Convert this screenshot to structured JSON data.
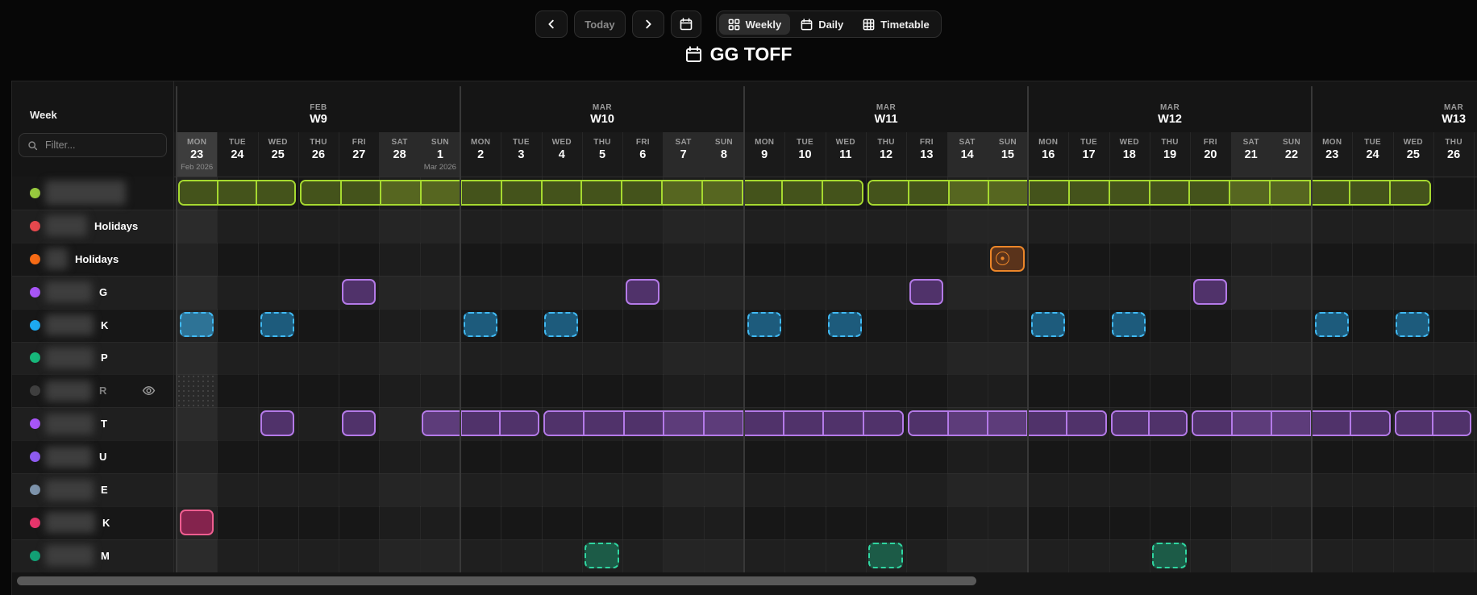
{
  "toolbar": {
    "prev_icon": "chevron-left-icon",
    "today_label": "Today",
    "next_icon": "chevron-right-icon",
    "date_picker_icon": "calendar-icon",
    "views": [
      {
        "label": "Weekly",
        "icon": "grid-icon",
        "active": true
      },
      {
        "label": "Daily",
        "icon": "calendar-icon",
        "active": false
      },
      {
        "label": "Timetable",
        "icon": "table-icon",
        "active": false
      }
    ]
  },
  "header": {
    "title": "GG TOFF",
    "title_icon": "calendar-icon"
  },
  "sidebar": {
    "heading": "Week",
    "filter_placeholder": "Filter...",
    "search_icon": "search-icon"
  },
  "calendar": {
    "weeks": [
      {
        "month": "FEB",
        "label": "W9",
        "days": [
          {
            "dow": "MON",
            "num": "23",
            "sub": "Feb 2026",
            "today": true
          },
          {
            "dow": "TUE",
            "num": "24"
          },
          {
            "dow": "WED",
            "num": "25"
          },
          {
            "dow": "THU",
            "num": "26"
          },
          {
            "dow": "FRI",
            "num": "27"
          },
          {
            "dow": "SAT",
            "num": "28",
            "weekend": true
          },
          {
            "dow": "SUN",
            "num": "1",
            "weekend": true,
            "sub": "Mar 2026"
          }
        ]
      },
      {
        "month": "MAR",
        "label": "W10",
        "days": [
          {
            "dow": "MON",
            "num": "2"
          },
          {
            "dow": "TUE",
            "num": "3"
          },
          {
            "dow": "WED",
            "num": "4"
          },
          {
            "dow": "THU",
            "num": "5"
          },
          {
            "dow": "FRI",
            "num": "6"
          },
          {
            "dow": "SAT",
            "num": "7",
            "weekend": true
          },
          {
            "dow": "SUN",
            "num": "8",
            "weekend": true
          }
        ]
      },
      {
        "month": "MAR",
        "label": "W11",
        "days": [
          {
            "dow": "MON",
            "num": "9"
          },
          {
            "dow": "TUE",
            "num": "10"
          },
          {
            "dow": "WED",
            "num": "11"
          },
          {
            "dow": "THU",
            "num": "12"
          },
          {
            "dow": "FRI",
            "num": "13"
          },
          {
            "dow": "SAT",
            "num": "14",
            "weekend": true
          },
          {
            "dow": "SUN",
            "num": "15",
            "weekend": true
          }
        ]
      },
      {
        "month": "MAR",
        "label": "W12",
        "days": [
          {
            "dow": "MON",
            "num": "16"
          },
          {
            "dow": "TUE",
            "num": "17"
          },
          {
            "dow": "WED",
            "num": "18"
          },
          {
            "dow": "THU",
            "num": "19"
          },
          {
            "dow": "FRI",
            "num": "20"
          },
          {
            "dow": "SAT",
            "num": "21",
            "weekend": true
          },
          {
            "dow": "SUN",
            "num": "22",
            "weekend": true
          }
        ]
      },
      {
        "month": "MAR",
        "label": "W13",
        "days": [
          {
            "dow": "MON",
            "num": "23"
          },
          {
            "dow": "TUE",
            "num": "24"
          },
          {
            "dow": "WED",
            "num": "25"
          },
          {
            "dow": "THU",
            "num": "26"
          }
        ]
      }
    ],
    "schemes": {
      "lime": {
        "border": "#a6d930",
        "fill": "#44531b",
        "fill_weekend": "#566620"
      },
      "purple": {
        "border": "#b47ae8",
        "fill": "#50326a",
        "fill_weekend": "#5d3c7a"
      },
      "blue": {
        "border": "#41b9f2",
        "fill": "#1d5b7c",
        "fill_today": "#2e7396",
        "dashed": true
      },
      "green": {
        "border": "#30d6a1",
        "fill": "#1c5b47",
        "dashed": true
      },
      "pink": {
        "border": "#ef5e90",
        "fill": "#84234d"
      },
      "orange": {
        "border": "#ec8629",
        "fill": "#5a331b"
      }
    },
    "rows": [
      {
        "suffix": "",
        "dot": "#97c93e",
        "blur_w": 100,
        "events": [
          {
            "kind": "bar",
            "scheme": "lime",
            "start": 0,
            "span": 3,
            "textured_first": true
          },
          {
            "kind": "bar",
            "scheme": "lime",
            "start": 3,
            "span": 14
          },
          {
            "kind": "bar",
            "scheme": "lime",
            "start": 17,
            "span": 14
          }
        ]
      },
      {
        "suffix": "Holidays",
        "dot": "#e5484d",
        "blur_w": 52,
        "events": []
      },
      {
        "suffix": "Holidays",
        "dot": "#f76b15",
        "blur_w": 28,
        "events": [
          {
            "kind": "badge",
            "scheme": "orange",
            "start": 20,
            "span": 1,
            "icon": "holiday-badge-icon"
          }
        ]
      },
      {
        "suffix": "G",
        "dot": "#a855f7",
        "blur_w": 58,
        "events": [
          {
            "kind": "solid",
            "scheme": "purple",
            "start": 4
          },
          {
            "kind": "solid",
            "scheme": "purple",
            "start": 11
          },
          {
            "kind": "solid",
            "scheme": "purple",
            "start": 18
          },
          {
            "kind": "solid",
            "scheme": "purple",
            "start": 25
          }
        ]
      },
      {
        "suffix": "K",
        "dot": "#1daaf1",
        "blur_w": 60,
        "events": [
          {
            "kind": "dashed",
            "scheme": "blue",
            "start": 0,
            "textured": true
          },
          {
            "kind": "dashed",
            "scheme": "blue",
            "start": 2
          },
          {
            "kind": "dashed",
            "scheme": "blue",
            "start": 7
          },
          {
            "kind": "dashed",
            "scheme": "blue",
            "start": 9
          },
          {
            "kind": "dashed",
            "scheme": "blue",
            "start": 14
          },
          {
            "kind": "dashed",
            "scheme": "blue",
            "start": 16
          },
          {
            "kind": "dashed",
            "scheme": "blue",
            "start": 21
          },
          {
            "kind": "dashed",
            "scheme": "blue",
            "start": 23
          },
          {
            "kind": "dashed",
            "scheme": "blue",
            "start": 28
          },
          {
            "kind": "dashed",
            "scheme": "blue",
            "start": 30
          }
        ]
      },
      {
        "suffix": "P",
        "dot": "#17b87b",
        "blur_w": 60,
        "events": []
      },
      {
        "suffix": "R",
        "dot": "#3f3f3f",
        "dim": true,
        "eye": true,
        "blur_w": 58,
        "events": [
          {
            "kind": "hatch",
            "start": 0,
            "span": 1
          }
        ]
      },
      {
        "suffix": "T",
        "dot": "#a855f7",
        "blur_w": 60,
        "events": [
          {
            "kind": "solid",
            "scheme": "purple",
            "start": 2
          },
          {
            "kind": "solid",
            "scheme": "purple",
            "start": 4
          },
          {
            "kind": "bar",
            "scheme": "purple",
            "start": 6,
            "span": 3
          },
          {
            "kind": "bar",
            "scheme": "purple",
            "start": 9,
            "span": 9
          },
          {
            "kind": "bar",
            "scheme": "purple",
            "start": 18,
            "span": 5
          },
          {
            "kind": "bar",
            "scheme": "purple",
            "start": 23,
            "span": 2
          },
          {
            "kind": "bar",
            "scheme": "purple",
            "start": 25,
            "span": 5
          },
          {
            "kind": "bar",
            "scheme": "purple",
            "start": 30,
            "span": 2
          }
        ]
      },
      {
        "suffix": "U",
        "dot": "#8e5bf0",
        "blur_w": 58,
        "events": []
      },
      {
        "suffix": "E",
        "dot": "#7d93ab",
        "blur_w": 60,
        "events": []
      },
      {
        "suffix": "K",
        "dot": "#e5356b",
        "blur_w": 62,
        "events": [
          {
            "kind": "solid",
            "scheme": "pink",
            "start": 0
          }
        ]
      },
      {
        "suffix": "M",
        "dot": "#12a075",
        "blur_w": 60,
        "events": [
          {
            "kind": "dashed",
            "scheme": "green",
            "start": 10
          },
          {
            "kind": "dashed",
            "scheme": "green",
            "start": 17
          },
          {
            "kind": "dashed",
            "scheme": "green",
            "start": 24
          }
        ]
      }
    ],
    "ui_colors": {
      "panel_bg": "#151515",
      "stripe_dark": "#171717",
      "stripe_light": "#1f1f1f",
      "day_band_bg": "#1a1a1a",
      "weekend_header_bg": "#2a2a2a",
      "today_header_bg": "#3d3d3d",
      "week_line": "#383838",
      "day_line": "#272727"
    }
  }
}
